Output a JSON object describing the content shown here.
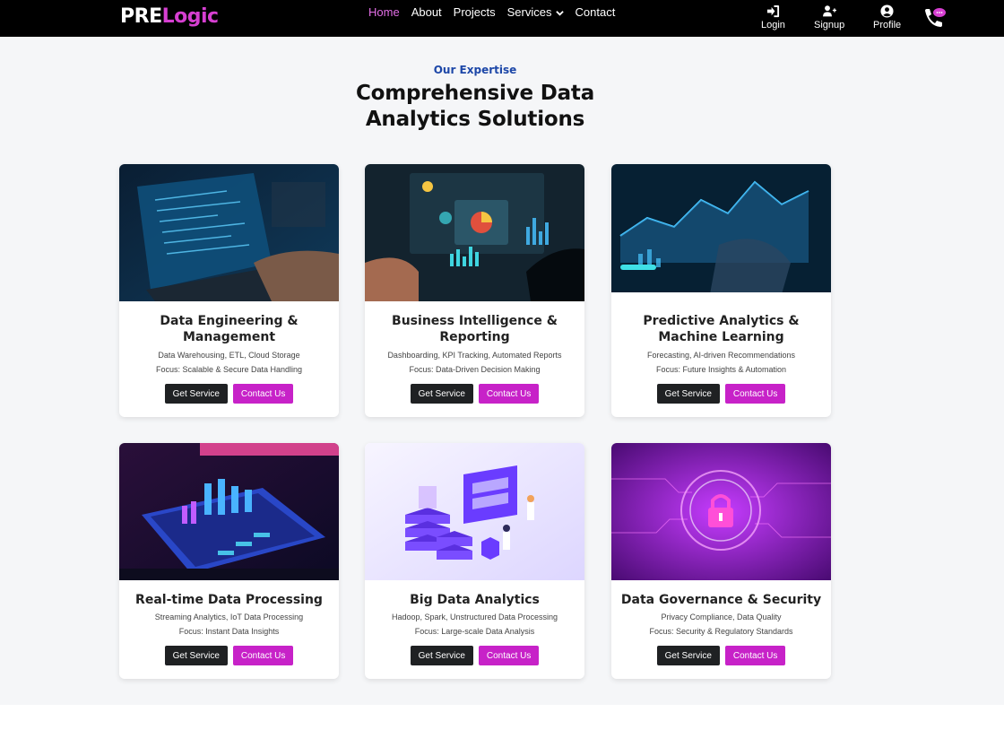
{
  "brand": {
    "pre": "PRE",
    "logic": "Logic"
  },
  "nav": {
    "links": [
      "Home",
      "About",
      "Projects",
      "Services",
      "Contact"
    ],
    "login": "Login",
    "signup": "Signup",
    "profile": "Profile"
  },
  "colors": {
    "accent": "#c722c8",
    "brand_pink": "#d63fd1",
    "heading_blue": "#1d47a8",
    "dark_button": "#1f2123"
  },
  "section": {
    "subtitle": "Our Expertise",
    "title": "Comprehensive Data Analytics Solutions"
  },
  "cards": [
    {
      "title": "Data Engineering & Management",
      "line1": "Data Warehousing, ETL, Cloud Storage",
      "line2": "Focus: Scalable & Secure Data Handling",
      "btn1": "Get Service",
      "btn2": "Contact Us"
    },
    {
      "title": "Business Intelligence & Reporting",
      "line1": "Dashboarding, KPI Tracking, Automated Reports",
      "line2": "Focus: Data-Driven Decision Making",
      "btn1": "Get Service",
      "btn2": "Contact Us"
    },
    {
      "title": "Predictive Analytics & Machine Learning",
      "line1": "Forecasting, AI-driven Recommendations",
      "line2": "Focus: Future Insights & Automation",
      "btn1": "Get Service",
      "btn2": "Contact Us"
    },
    {
      "title": "Real-time Data Processing",
      "line1": "Streaming Analytics, IoT Data Processing",
      "line2": "Focus: Instant Data Insights",
      "btn1": "Get Service",
      "btn2": "Contact Us"
    },
    {
      "title": "Big Data Analytics",
      "line1": "Hadoop, Spark, Unstructured Data Processing",
      "line2": "Focus: Large-scale Data Analysis",
      "btn1": "Get Service",
      "btn2": "Contact Us"
    },
    {
      "title": "Data Governance & Security",
      "line1": "Privacy Compliance, Data Quality",
      "line2": "Focus: Security & Regulatory Standards",
      "btn1": "Get Service",
      "btn2": "Contact Us"
    }
  ]
}
